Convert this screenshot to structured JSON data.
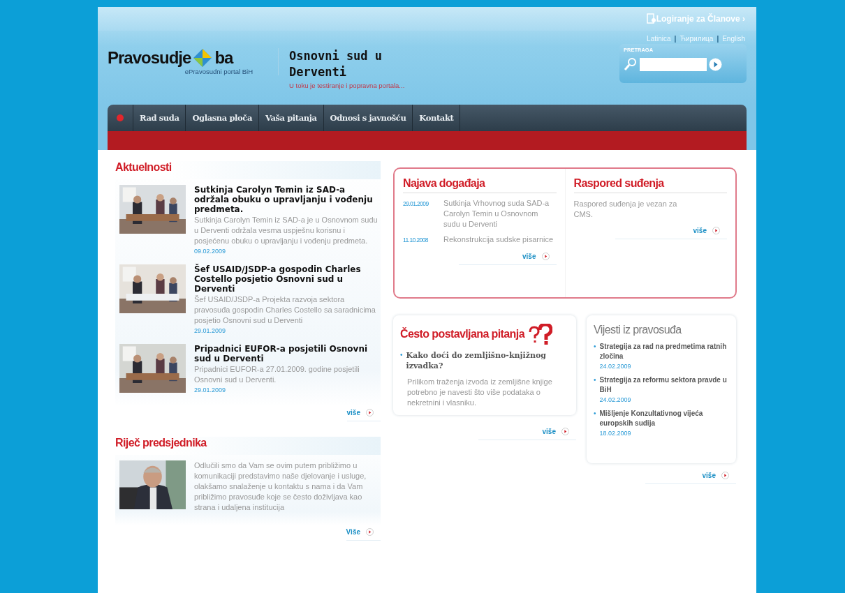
{
  "header": {
    "login": "Logiranje za Članove ›",
    "languages": [
      {
        "kind": "link",
        "label": "Latinica"
      },
      {
        "kind": "separator",
        "label": "|"
      },
      {
        "kind": "link",
        "label": "Ћирилица"
      },
      {
        "kind": "separator",
        "label": "|"
      },
      {
        "kind": "link",
        "label": "English"
      }
    ],
    "logo": {
      "name": "Pravosudje",
      "domain": "ba",
      "subtitle": "ePravosudni portal BiH"
    },
    "court_title": "Osnovni sud u Derventi",
    "notice": "U toku je testiranje i popravna portala...",
    "search": {
      "label": "PRETRAGA"
    }
  },
  "nav": [
    {
      "label": "Rad suda"
    },
    {
      "label": "Oglasna ploča"
    },
    {
      "label": "Vaša pitanja"
    },
    {
      "label": "Odnosi s javnošću"
    },
    {
      "label": "Kontakt"
    }
  ],
  "news": {
    "title": "Aktuelnosti",
    "items": [
      {
        "title": "Sutkinja Carolyn Temin iz SAD-a održala obuku o upravljanju i vođenju predmeta.",
        "summary": "Sutkinja Carolyn Temin iz SAD-a je u Osnovnom sudu u Derventi održala vesma uspješnu korisnu i posjećenu obuku o upravljanju i vođenju predmeta.",
        "date": "09.02.2009"
      },
      {
        "title": "Šef USAID/JSDP-a gospodin Charles Costello posjetio Osnovni sud u Derventi",
        "summary": "Šef USAID/JSDP-a Projekta razvoja sektora pravosuđa gospodin Charles Costello sa saradnicima posjetio Osnovni sud u Derventi",
        "date": "29.01.2009"
      },
      {
        "title": "Pripadnici EUFOR-a posjetili Osnovni sud u Derventi",
        "summary": "Pripadnici EUFOR-a 27.01.2009. godine posjetili Osnovni sud u Derventi.",
        "date": "29.01.2009"
      }
    ],
    "more": "više"
  },
  "president": {
    "title": "Riječ predsjednika",
    "text": "Odlučili smo da Vam se ovim putem približimo u komunikaciji predstavimo naše djelovanje i usluge, olakšamo snalaženje u kontaktu s nama i da Vam približimo pravosuđe koje se često doživljava kao strana i udaljena institucija",
    "more": "Više"
  },
  "events": {
    "title": "Najava događaja",
    "items": [
      {
        "date": "29.01.2009",
        "text": "Sutkinja Vrhovnog suda SAD-a Carolyn Temin u Osnovnom sudu u Derventi"
      },
      {
        "date": "11.10.2008",
        "text": "Rekonstrukcija sudske pisarnice"
      }
    ],
    "more": "više"
  },
  "schedule": {
    "title": "Raspored suđenja",
    "text": "Raspored suđenja je vezan za CMS.",
    "more": "više"
  },
  "faq": {
    "title": "Često postavljana pitanja",
    "bullet": "•",
    "question": "Kako doći do zemljišno-knjižnog izvadka?",
    "answer": "Prilikom traženja izvoda iz zemljišne knjige potrebno je navesti što više podataka o nekretnini i vlasniku.",
    "more": "više"
  },
  "judiciary_news": {
    "title": "Vijesti iz pravosuđa",
    "items": [
      {
        "bullet": "•",
        "title": "Strategija za rad na predmetima ratnih zločina",
        "date": "24.02.2009"
      },
      {
        "bullet": "•",
        "title": "Strategija za reformu sektora pravde u BiH",
        "date": "24.02.2009"
      },
      {
        "bullet": "•",
        "title": "Mišljenje Konzultativnog vijeća europskih sudija",
        "date": "18.02.2009"
      }
    ],
    "more": "više"
  }
}
